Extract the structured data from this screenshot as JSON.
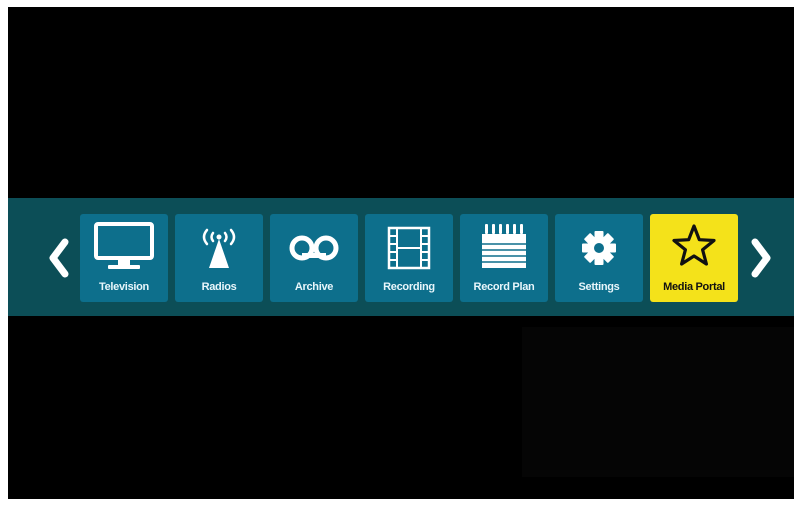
{
  "colors": {
    "screen_background": "#000000",
    "menu_bar": "#0c4e57",
    "tile": "#0d6f8c",
    "tile_active": "#f4e21a",
    "icon": "#ffffff",
    "label": "#e8f6fb",
    "label_active": "#111111"
  },
  "menu": {
    "previous_icon": "chevron-left-icon",
    "next_icon": "chevron-right-icon",
    "selected_index": 6,
    "items": [
      {
        "label": "Television",
        "icon": "tv-icon"
      },
      {
        "label": "Radios",
        "icon": "antenna-icon"
      },
      {
        "label": "Archive",
        "icon": "tape-icon"
      },
      {
        "label": "Recording",
        "icon": "film-icon"
      },
      {
        "label": "Record Plan",
        "icon": "calendar-icon"
      },
      {
        "label": "Settings",
        "icon": "gear-icon"
      },
      {
        "label": "Media Portal",
        "icon": "star-icon"
      }
    ]
  }
}
